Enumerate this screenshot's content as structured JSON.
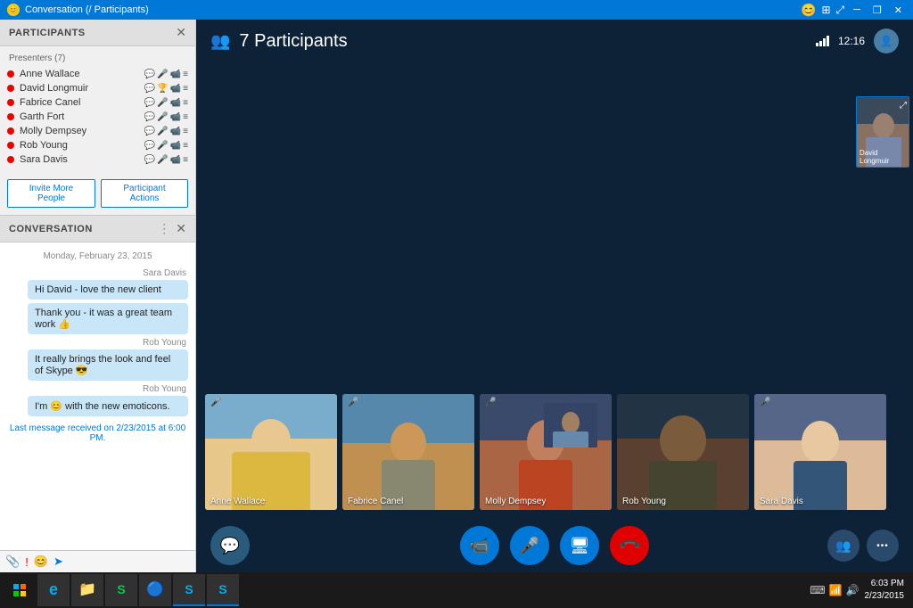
{
  "titlebar": {
    "title": "Conversation (/ Participants)",
    "icon_label": "S",
    "controls": [
      "smile",
      "grid",
      "expand",
      "minimize",
      "restore",
      "close"
    ]
  },
  "participants_panel": {
    "title": "PARTICIPANTS",
    "section_label": "Presenters (7)",
    "participants": [
      {
        "name": "Anne Wallace",
        "status": "active"
      },
      {
        "name": "David Longmuir",
        "status": "active"
      },
      {
        "name": "Fabrice Canel",
        "status": "active"
      },
      {
        "name": "Garth Fort",
        "status": "active"
      },
      {
        "name": "Molly Dempsey",
        "status": "active"
      },
      {
        "name": "Rob Young",
        "status": "active"
      },
      {
        "name": "Sara Davis",
        "status": "active"
      }
    ],
    "invite_btn": "Invite More People",
    "actions_btn": "Participant Actions"
  },
  "conversation_panel": {
    "title": "CONVERSATION",
    "date": "Monday, February 23, 2015",
    "messages": [
      {
        "sender": "Sara Davis",
        "text": "Hi David - love the new client",
        "align": "self"
      },
      {
        "sender": "",
        "text": "Thank you - it was a great team work 👍",
        "align": "self"
      },
      {
        "sender": "Rob Young",
        "text": "It really brings the look and feel of Skype 😎",
        "align": "self"
      },
      {
        "sender": "Rob Young",
        "text": "I'm 😊 with the new emoticons.",
        "align": "self"
      }
    ],
    "last_msg_notice": "Last message received on 2/23/2015 at 6:00 PM."
  },
  "video_area": {
    "participants_count": "7 Participants",
    "time": "12:16",
    "tiles": [
      {
        "name": "Anne Wallace",
        "muted": true,
        "photo_class": "person-bg-anne"
      },
      {
        "name": "Fabrice Canel",
        "muted": true,
        "photo_class": "person-bg-fabrice"
      },
      {
        "name": "Molly Dempsey",
        "muted": true,
        "photo_class": "person-bg-molly"
      },
      {
        "name": "Rob Young",
        "muted": false,
        "photo_class": "person-bg-rob"
      },
      {
        "name": "Sara Davis",
        "muted": true,
        "photo_class": "person-bg-sara"
      }
    ],
    "small_tile_name": "David Longmuir"
  },
  "controls": {
    "chat_label": "💬",
    "video_label": "📹",
    "mic_label": "🎤",
    "screen_label": "🖥",
    "end_label": "📞",
    "participants_label": "👥",
    "more_label": "•••"
  },
  "taskbar": {
    "time": "6:03 PM",
    "date": "2/23/2015",
    "apps": [
      {
        "icon": "⊞",
        "name": "start",
        "active": false
      },
      {
        "icon": "🌐",
        "name": "ie",
        "active": false
      },
      {
        "icon": "📁",
        "name": "explorer",
        "active": false
      },
      {
        "icon": "S",
        "name": "store",
        "active": false
      },
      {
        "icon": "C",
        "name": "chrome",
        "active": false
      },
      {
        "icon": "S",
        "name": "skype-taskbar",
        "active": true
      },
      {
        "icon": "S",
        "name": "skype2",
        "active": true
      }
    ]
  }
}
